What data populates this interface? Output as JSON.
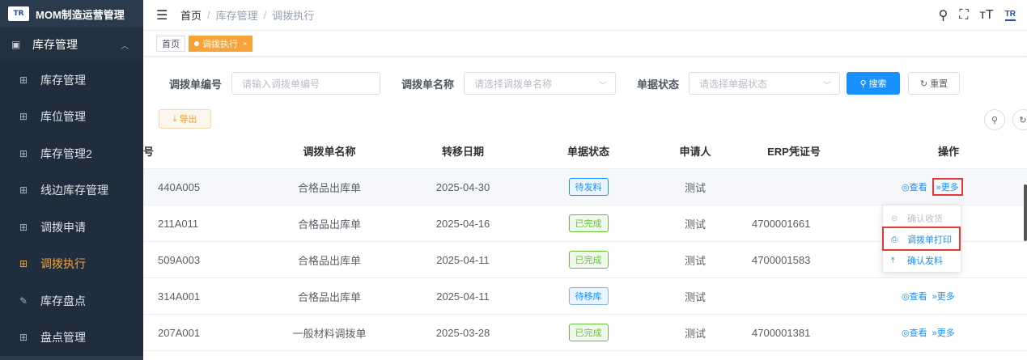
{
  "app": {
    "title": "MOM制造运营管理",
    "logo_text": "TR"
  },
  "sidebar": {
    "group": {
      "label": "库存管理",
      "icon": "monitor-icon"
    },
    "items": [
      {
        "label": "库存管理",
        "icon": "table-icon",
        "active": false
      },
      {
        "label": "库位管理",
        "icon": "table-icon",
        "active": false
      },
      {
        "label": "库存管理2",
        "icon": "table-icon",
        "active": false
      },
      {
        "label": "线边库存管理",
        "icon": "table-icon",
        "active": false
      },
      {
        "label": "调拨申请",
        "icon": "table-icon",
        "active": false
      },
      {
        "label": "调拨执行",
        "icon": "table-icon",
        "active": true
      },
      {
        "label": "库存盘点",
        "icon": "edit-icon",
        "active": false
      },
      {
        "label": "盘点管理",
        "icon": "table-icon",
        "active": false
      }
    ]
  },
  "breadcrumb": {
    "home": "首页",
    "sep": "/",
    "level1": "库存管理",
    "level2": "调拨执行"
  },
  "header_icons": [
    "search-icon",
    "fullscreen-icon",
    "font-size-icon",
    "brand-logo"
  ],
  "tags": {
    "home": "首页",
    "current": "调拨执行",
    "close": "×"
  },
  "search": {
    "code_label": "调拨单编号",
    "code_placeholder": "请输入调拨单编号",
    "name_label": "调拨单名称",
    "name_placeholder": "请选择调拨单名称",
    "status_label": "单据状态",
    "status_placeholder": "请选择单据状态",
    "search_btn": "搜索",
    "reset_btn": "重置"
  },
  "toolbar": {
    "export_btn": "导出"
  },
  "table": {
    "columns": [
      "号",
      "调拨单名称",
      "转移日期",
      "单据状态",
      "申请人",
      "ERP凭证号",
      "操作"
    ],
    "rows": [
      {
        "code": "440A005",
        "name": "合格品出库单",
        "date": "2025-04-30",
        "status": "待发料",
        "applicant": "测试",
        "erp": "",
        "view": "查看",
        "more": "更多"
      },
      {
        "code": "211A011",
        "name": "合格品出库单",
        "date": "2025-04-16",
        "status": "已完成",
        "applicant": "测试",
        "erp": "4700001661",
        "view": "",
        "more": ""
      },
      {
        "code": "509A003",
        "name": "合格品出库单",
        "date": "2025-04-11",
        "status": "已完成",
        "applicant": "测试",
        "erp": "4700001583",
        "view": "",
        "more": ""
      },
      {
        "code": "314A001",
        "name": "合格品出库单",
        "date": "2025-04-11",
        "status": "待移库",
        "applicant": "测试",
        "erp": "",
        "view": "查看",
        "more": "更多"
      },
      {
        "code": "207A001",
        "name": "一般材料调拨单",
        "date": "2025-03-28",
        "status": "已完成",
        "applicant": "测试",
        "erp": "4700001381",
        "view": "查看",
        "more": "更多"
      }
    ]
  },
  "dropdown": {
    "items": [
      {
        "label": "确认收货",
        "icon": "receive-icon",
        "disabled": true
      },
      {
        "label": "调拨单打印",
        "icon": "print-icon",
        "disabled": false
      },
      {
        "label": "确认发料",
        "icon": "upload-icon",
        "disabled": false
      }
    ]
  },
  "colors": {
    "sidebar_bg": "#2b3a4d",
    "accent": "#f6a33a",
    "primary": "#1890ff",
    "success": "#67c23a",
    "highlight": "#e53935"
  }
}
